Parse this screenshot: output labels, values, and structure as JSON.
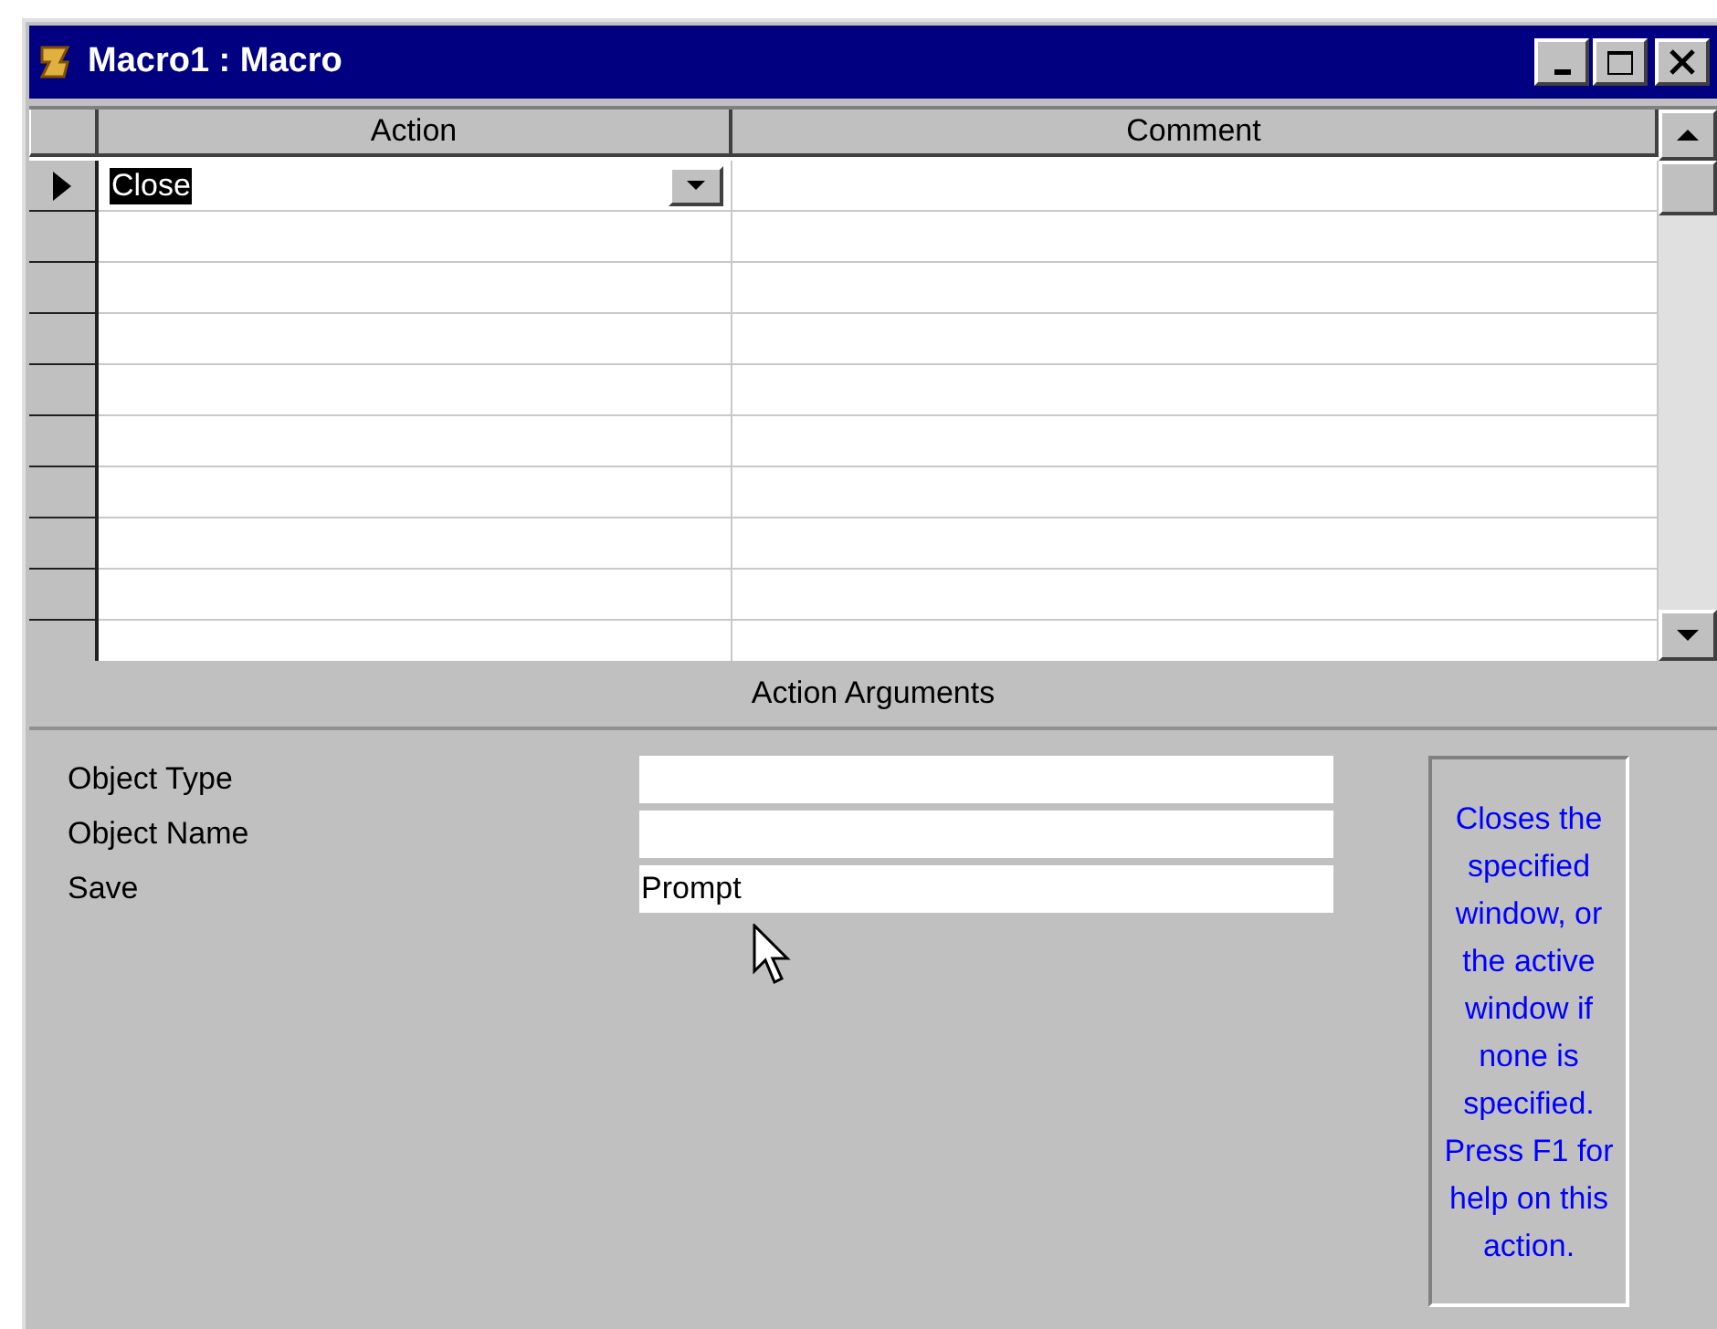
{
  "window": {
    "title": "Macro1 : Macro"
  },
  "grid": {
    "columns": [
      "Action",
      "Comment"
    ],
    "rows": [
      {
        "action": "Close",
        "current": true,
        "selected": true,
        "dropdown": true
      }
    ]
  },
  "arguments": {
    "heading": "Action Arguments",
    "fields": [
      {
        "label": "Object Type"
      },
      {
        "label": "Object Name"
      },
      {
        "label": "Save",
        "value": "Prompt"
      }
    ],
    "help": "Closes the specified window, or the active window if none is specified. Press F1 for help on this action."
  }
}
